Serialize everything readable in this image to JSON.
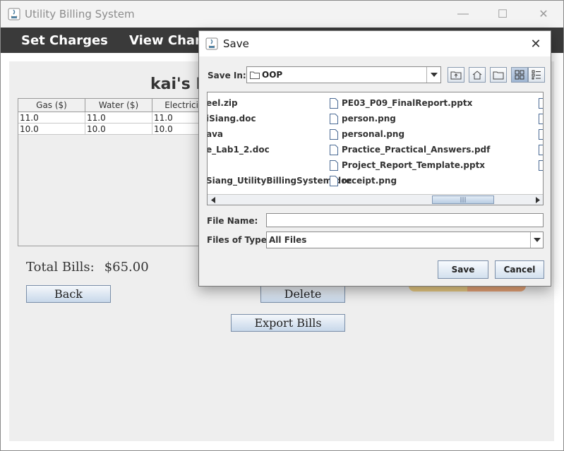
{
  "window": {
    "title": "Utility Billing System",
    "minimize": "—",
    "maximize": "☐",
    "close": "✕"
  },
  "menu": {
    "items": [
      "Set Charges",
      "View Charg"
    ]
  },
  "main": {
    "heading": "kai's B",
    "table": {
      "columns": [
        "Gas ($)",
        "Water ($)",
        "Electricity"
      ],
      "rows": [
        [
          "11.0",
          "11.0",
          "11.0"
        ],
        [
          "10.0",
          "10.0",
          "10.0"
        ]
      ]
    },
    "total_label": "Total Bills:",
    "total_value": "$65.00",
    "back_label": "Back",
    "delete_label": "Delete",
    "export_label": "Export Bills"
  },
  "dialog": {
    "title": "Save",
    "close": "✕",
    "save_in_label": "Save In:",
    "save_in_value": "OOP",
    "files_left": [
      "eel.zip",
      "iSiang.doc",
      "ava",
      "e_Lab1_2.doc",
      "",
      "Siang_UtilityBillingSystem.doc"
    ],
    "files_right": [
      "PE03_P09_FinalReport.pptx",
      "person.png",
      "personal.png",
      "Practice_Practical_Answers.pdf",
      "Project_Report_Template.pptx",
      "receipt.png"
    ],
    "file_name_label": "File Name:",
    "file_name_value": "",
    "files_of_type_label": "Files of Type:",
    "files_of_type_value": "All Files",
    "save_button": "Save",
    "cancel_button": "Cancel"
  }
}
